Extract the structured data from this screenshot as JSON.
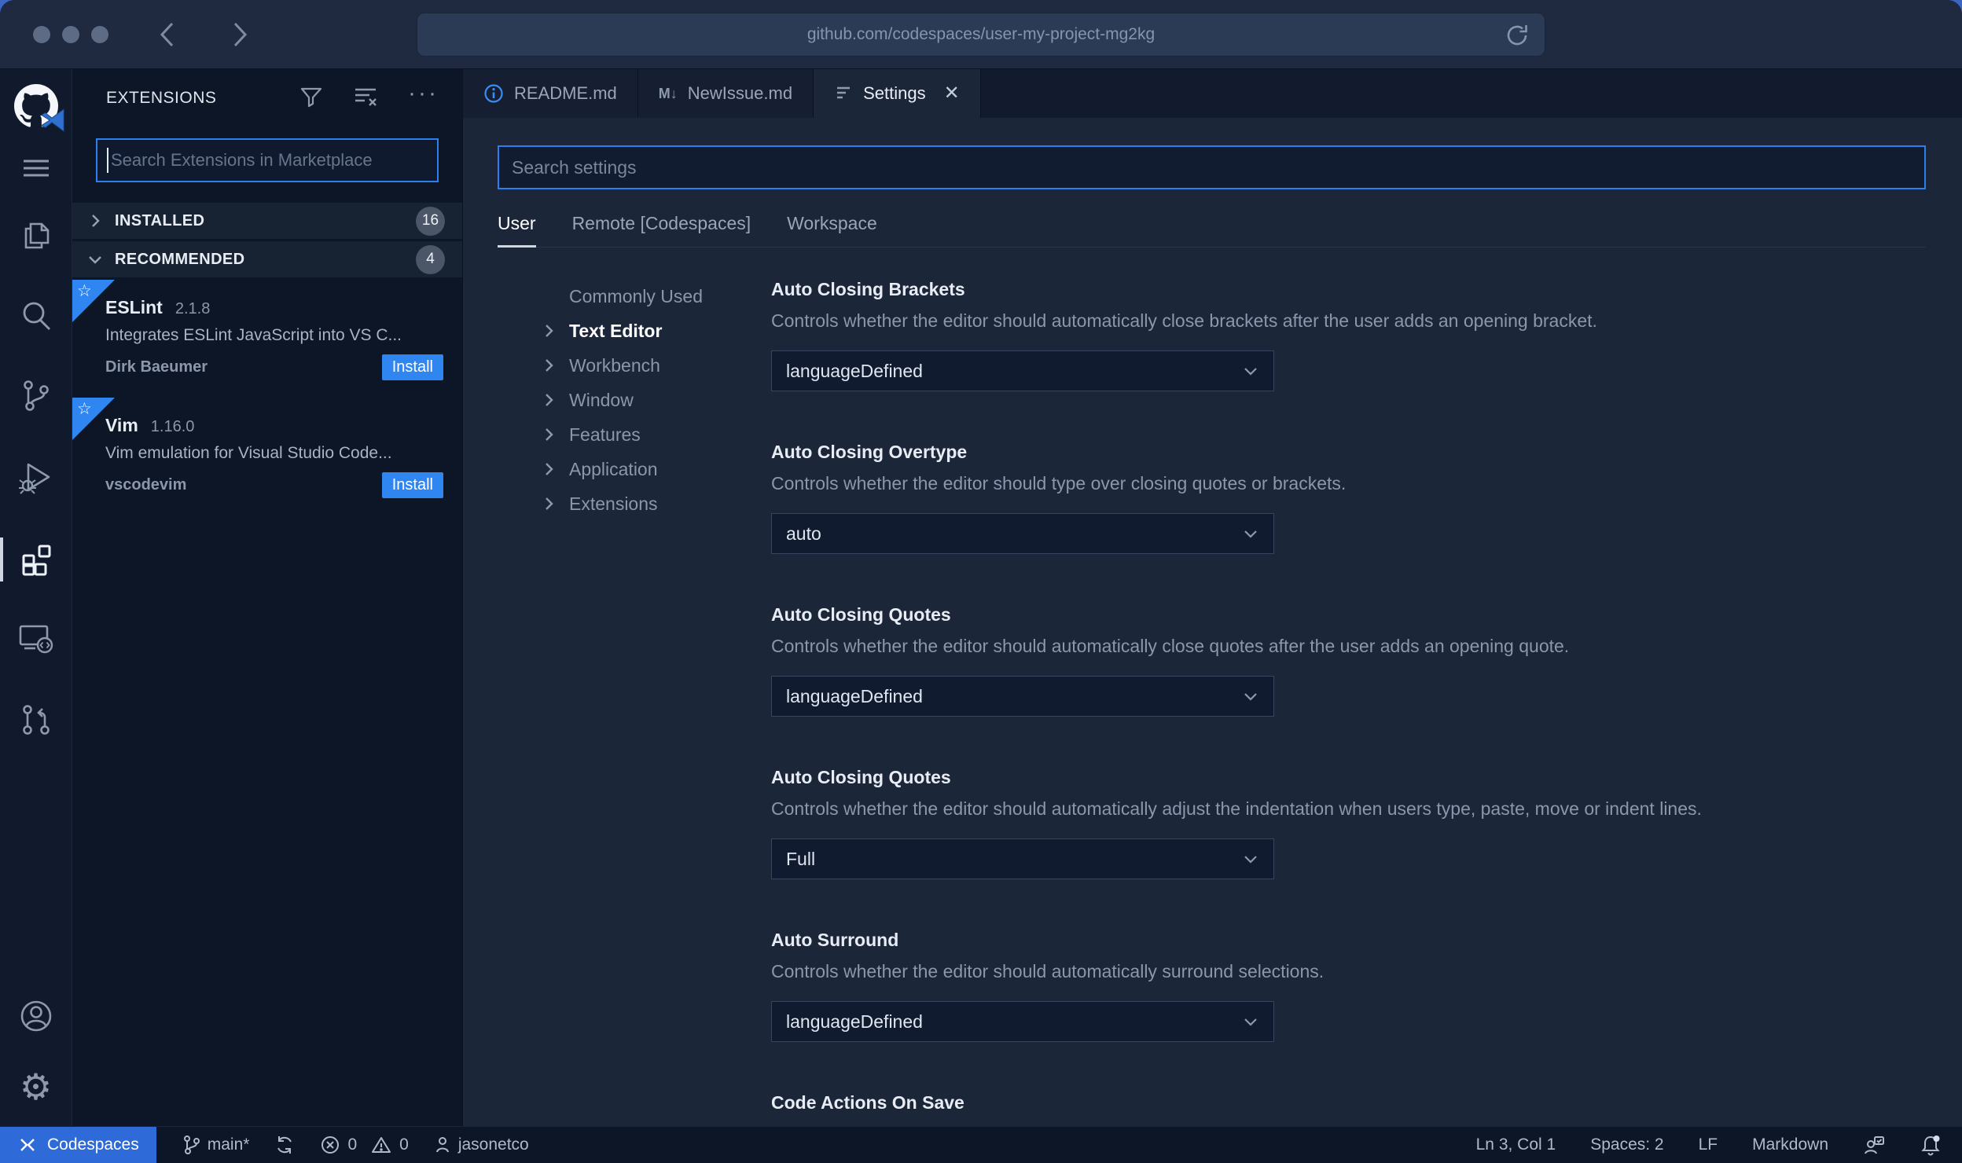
{
  "colors": {
    "accent": "#2f86f0",
    "focus": "#2d7ff0",
    "status-blue": "#2e6bd9",
    "info-blue": "#3b8df2"
  },
  "browser": {
    "url": "github.com/codespaces/user-my-project-mg2kg"
  },
  "activity_bar": {
    "items": [
      {
        "icon": "github-vscode-logo"
      },
      {
        "icon": "menu"
      },
      {
        "icon": "explorer-files"
      },
      {
        "icon": "search"
      },
      {
        "icon": "source-control"
      },
      {
        "icon": "run-debug"
      },
      {
        "icon": "extensions",
        "active": true
      },
      {
        "icon": "remote-explorer"
      },
      {
        "icon": "pull-requests"
      }
    ],
    "bottom": [
      {
        "icon": "account"
      },
      {
        "icon": "settings-gear"
      }
    ]
  },
  "extensions_panel": {
    "title": "EXTENSIONS",
    "header_icons": [
      "filter-icon",
      "clear-search-icon",
      "more-actions-icon"
    ],
    "search_placeholder": "Search Extensions in Marketplace",
    "sections": [
      {
        "label": "INSTALLED",
        "count": "16",
        "state": "collapsed"
      },
      {
        "label": "RECOMMENDED",
        "count": "4",
        "state": "expanded"
      }
    ],
    "items": [
      {
        "name": "ESLint",
        "version": "2.1.8",
        "description": "Integrates ESLint JavaScript into VS C...",
        "author": "Dirk Baeumer",
        "action": "Install"
      },
      {
        "name": "Vim",
        "version": "1.16.0",
        "description": "Vim emulation for Visual Studio Code...",
        "author": "vscodevim",
        "action": "Install"
      }
    ]
  },
  "editor": {
    "tabs": [
      {
        "label": "README.md",
        "icon": "info-icon",
        "active": false
      },
      {
        "label": "NewIssue.md",
        "icon": "markdown-icon",
        "markdown_glyph": "M↓",
        "active": false
      },
      {
        "label": "Settings",
        "icon": "settings-editor-icon",
        "active": true,
        "close": "✕"
      }
    ],
    "settings": {
      "search_placeholder": "Search settings",
      "scopes": [
        {
          "label": "User",
          "active": true
        },
        {
          "label": "Remote [Codespaces]",
          "active": false
        },
        {
          "label": "Workspace",
          "active": false
        }
      ],
      "toc": [
        {
          "label": "Commonly Used",
          "chevron": false,
          "active": false
        },
        {
          "label": "Text Editor",
          "chevron": true,
          "active": true
        },
        {
          "label": "Workbench",
          "chevron": true,
          "active": false
        },
        {
          "label": "Window",
          "chevron": true,
          "active": false
        },
        {
          "label": "Features",
          "chevron": true,
          "active": false
        },
        {
          "label": "Application",
          "chevron": true,
          "active": false
        },
        {
          "label": "Extensions",
          "chevron": true,
          "active": false
        }
      ],
      "items": [
        {
          "title": "Auto Closing Brackets",
          "description": "Controls whether the editor should automatically close brackets after the user adds an opening bracket.",
          "value": "languageDefined"
        },
        {
          "title": "Auto Closing Overtype",
          "description": "Controls whether the editor should type over closing quotes or brackets.",
          "value": "auto"
        },
        {
          "title": "Auto Closing Quotes",
          "description": "Controls whether the editor should automatically close quotes after the user adds an opening quote.",
          "value": "languageDefined"
        },
        {
          "title": "Auto Closing Quotes",
          "description": "Controls whether the editor should automatically adjust the indentation when users type, paste, move or indent lines.",
          "value": "Full"
        },
        {
          "title": "Auto Surround",
          "description": "Controls whether the editor should automatically surround selections.",
          "value": "languageDefined"
        },
        {
          "title": "Code Actions On Save"
        }
      ]
    }
  },
  "status_bar": {
    "remote": {
      "label": "Codespaces",
      "icon": "remote-icon"
    },
    "left": [
      {
        "icon": "branch-icon",
        "label": "main*"
      },
      {
        "icon": "sync-icon",
        "label": ""
      },
      {
        "icon": "error-icon",
        "label": "0"
      },
      {
        "icon": "warning-icon",
        "label": "0"
      },
      {
        "icon": "person-icon",
        "label": "jasonetco"
      }
    ],
    "right": [
      {
        "label": "Ln 3, Col 1"
      },
      {
        "label": "Spaces: 2"
      },
      {
        "label": "LF"
      },
      {
        "label": "Markdown"
      },
      {
        "icon": "feedback-icon"
      },
      {
        "icon": "bell-icon"
      }
    ]
  }
}
